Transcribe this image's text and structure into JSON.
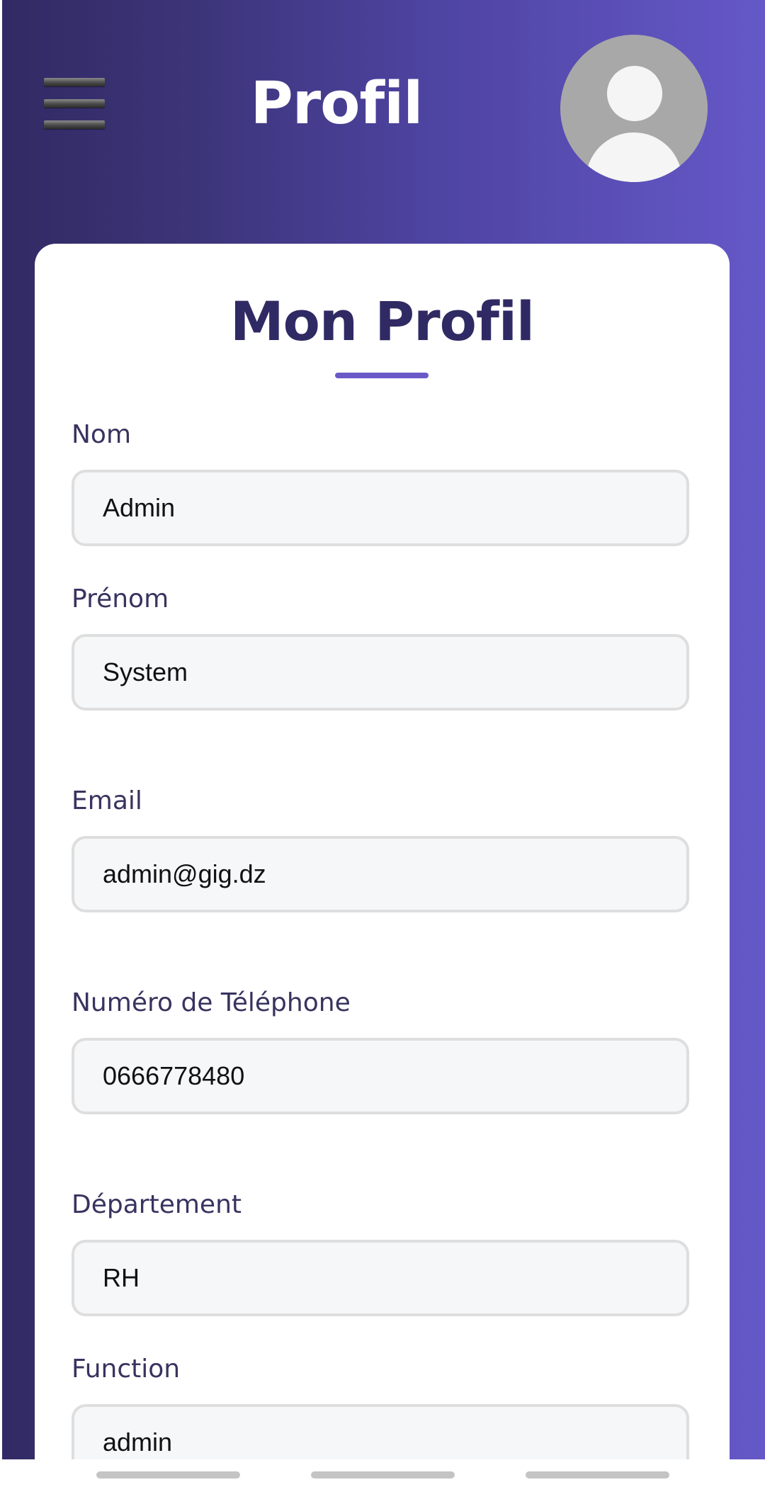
{
  "header": {
    "title": "Profil",
    "menu_icon": "hamburger-menu-icon",
    "avatar_icon": "user-avatar-icon"
  },
  "card": {
    "title": "Mon Profil",
    "fields": [
      {
        "label": "Nom",
        "value": "Admin"
      },
      {
        "label": "Prénom",
        "value": "System"
      },
      {
        "label": "Email",
        "value": "admin@gig.dz"
      },
      {
        "label": "Numéro de Téléphone",
        "value": "0666778480"
      },
      {
        "label": "Département",
        "value": "RH"
      },
      {
        "label": "Function",
        "value": "admin"
      }
    ]
  },
  "colors": {
    "gradient_start": "#312a63",
    "gradient_end": "#6558c8",
    "accent": "#6a5ac8",
    "label": "#38335f",
    "title": "#2f2a63"
  }
}
